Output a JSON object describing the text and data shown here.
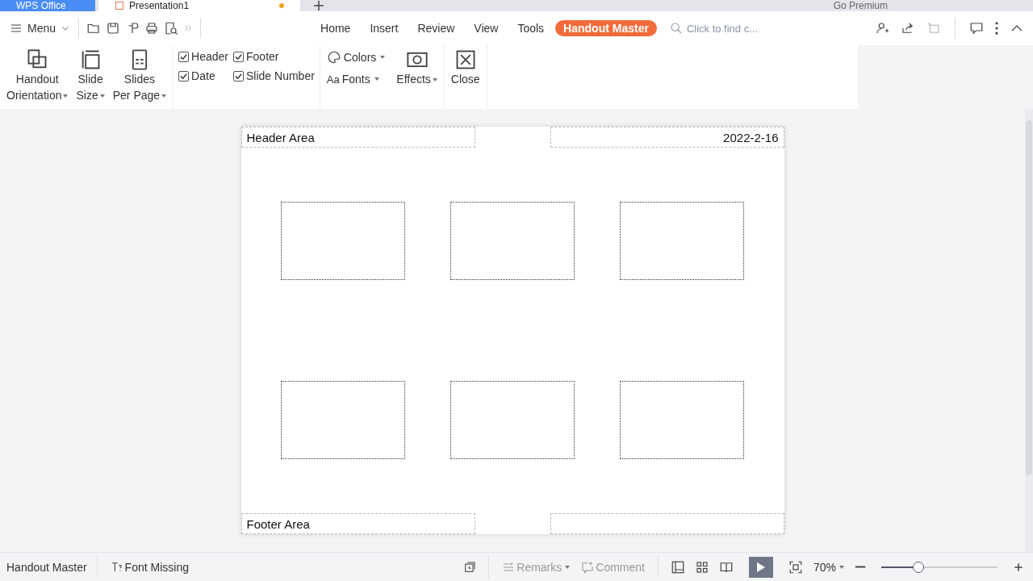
{
  "app_tabs": [
    {
      "label": "WPS Office",
      "selected": false,
      "kind": "home",
      "unsaved": false
    },
    {
      "label": "Presentation1",
      "selected": true,
      "kind": "doc",
      "unsaved": true
    }
  ],
  "account": {
    "label": "Go Premium"
  },
  "menu": {
    "label": "Menu"
  },
  "ribbon_tabs": [
    {
      "label": "Home",
      "selected": false
    },
    {
      "label": "Insert",
      "selected": false
    },
    {
      "label": "Review",
      "selected": false
    },
    {
      "label": "View",
      "selected": false
    },
    {
      "label": "Tools",
      "selected": false
    },
    {
      "label": "Handout Master",
      "selected": true
    }
  ],
  "search": {
    "placeholder": "Click to find c..."
  },
  "layout_buttons": [
    {
      "kind": "orientation",
      "lines": [
        "Handout",
        "Orientation"
      ]
    },
    {
      "kind": "size",
      "lines": [
        "Slide",
        "Size"
      ]
    },
    {
      "kind": "per-page",
      "lines": [
        "Slides",
        "Per Page"
      ]
    }
  ],
  "checkboxes": [
    {
      "label": "Header",
      "checked": true
    },
    {
      "label": "Footer",
      "checked": true
    },
    {
      "label": "Date",
      "checked": true
    },
    {
      "label": "Slide Number",
      "checked": true
    }
  ],
  "theme": {
    "colors": "Colors",
    "fonts_icon": "Aa",
    "fonts": "Fonts",
    "effects": "Effects"
  },
  "close": {
    "label": "Close"
  },
  "handout": {
    "header": "Header Area",
    "date": "2022-2-16",
    "footer": "Footer Area",
    "slides": [
      {
        "kind": "slide"
      },
      {
        "kind": "slide"
      },
      {
        "kind": "slide"
      },
      {
        "kind": "slide"
      },
      {
        "kind": "slide"
      },
      {
        "kind": "slide"
      }
    ]
  },
  "status_bar": {
    "mode": "Handout Master",
    "font_missing": "Font Missing",
    "remarks": "Remarks",
    "comment": "Comment",
    "zoom": "70%",
    "zoom_slider": {
      "level": 0.32
    }
  }
}
